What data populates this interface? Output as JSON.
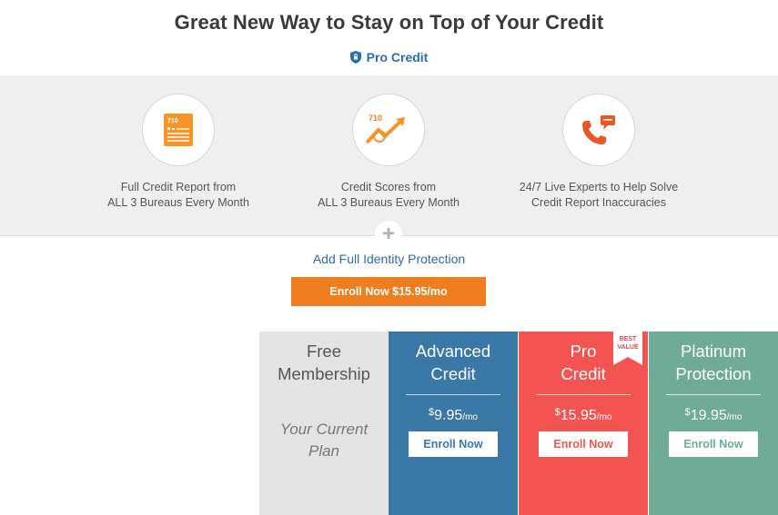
{
  "header": {
    "title": "Great New Way to Stay on Top of Your Credit",
    "brand": "Pro Credit"
  },
  "features": [
    {
      "icon": "credit-report-icon",
      "line1": "Full Credit Report from",
      "line2": "ALL 3 Bureaus Every Month",
      "badge": "710"
    },
    {
      "icon": "credit-score-icon",
      "line1": "Credit Scores from",
      "line2": "ALL 3 Bureaus Every Month",
      "badge": "710"
    },
    {
      "icon": "phone-chat-icon",
      "line1": "24/7 Live Experts to Help Solve",
      "line2": "Credit Report Inaccuracies"
    }
  ],
  "addon": {
    "plus": "+",
    "link": "Add Full Identity Protection",
    "button": "Enroll Now $15.95/mo"
  },
  "plans": {
    "free": {
      "name1": "Free",
      "name2": "Membership",
      "current1": "Your Current",
      "current2": "Plan"
    },
    "advanced": {
      "name1": "Advanced",
      "name2": "Credit",
      "currency": "$",
      "price": "9.95",
      "per": "/mo",
      "button": "Enroll Now"
    },
    "pro": {
      "name1": "Pro",
      "name2": "Credit",
      "currency": "$",
      "price": "15.95",
      "per": "/mo",
      "button": "Enroll Now",
      "ribbon1": "BEST",
      "ribbon2": "VALUE"
    },
    "platinum": {
      "name1": "Platinum",
      "name2": "Protection",
      "currency": "$",
      "price": "19.95",
      "per": "/mo",
      "button": "Enroll Now"
    }
  },
  "colors": {
    "accent_blue": "#2a6db0",
    "orange": "#f07d1e",
    "advanced": "#3a78a8",
    "pro": "#f35452",
    "platinum": "#6fab97",
    "free": "#e3e3e3"
  }
}
